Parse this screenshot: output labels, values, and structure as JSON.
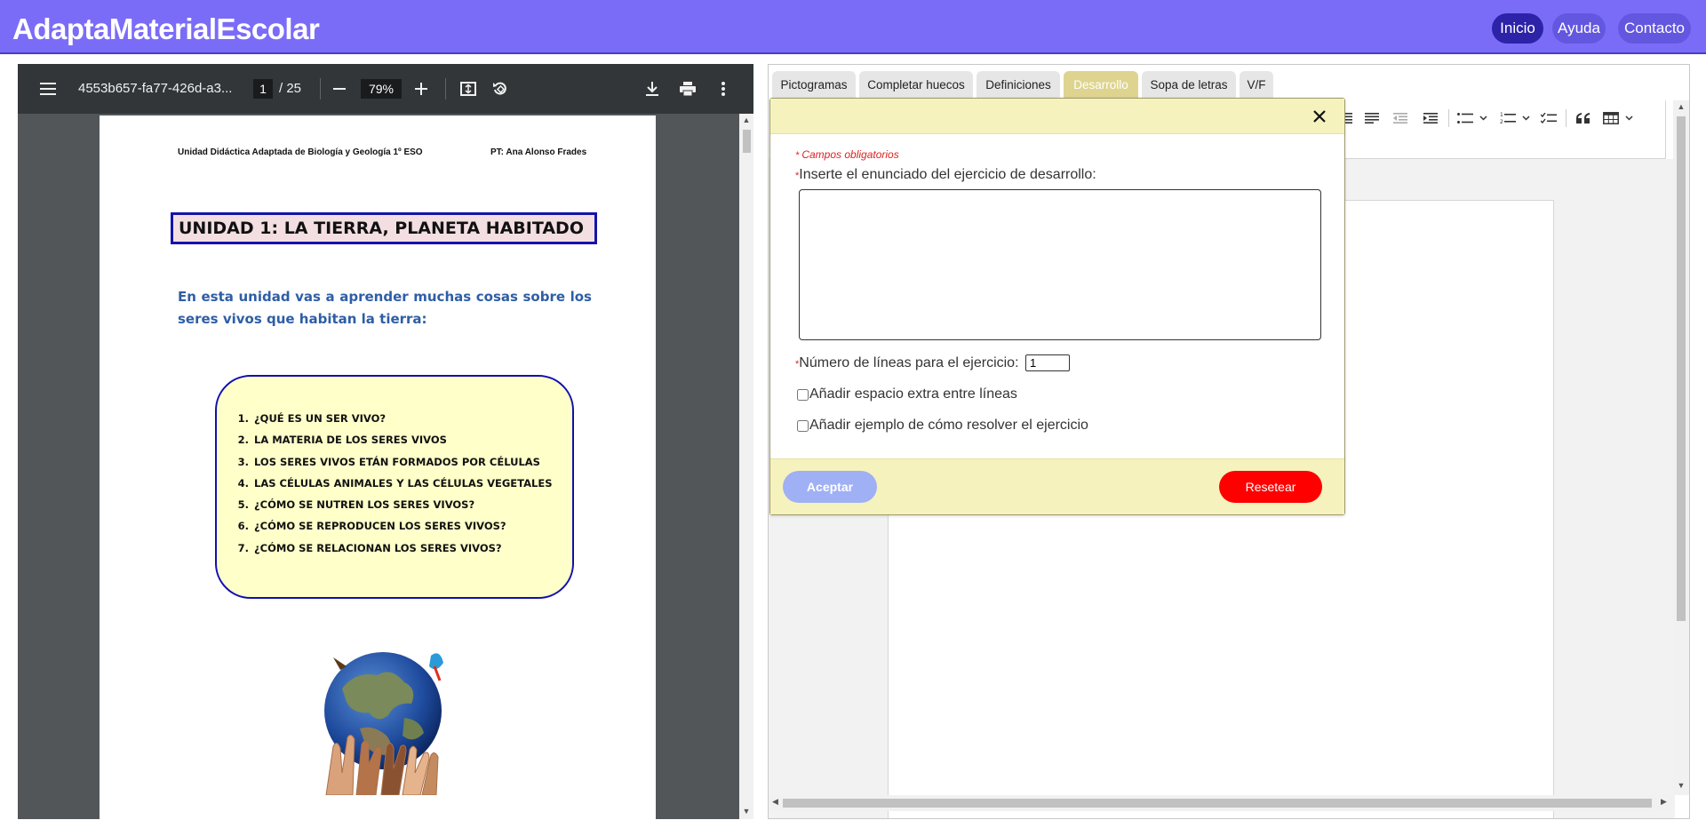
{
  "header": {
    "brand": "AdaptaMaterialEscolar",
    "nav": [
      "Inicio",
      "Ayuda",
      "Contacto"
    ],
    "active_nav": "Inicio",
    "colors": {
      "bar": "#7b6cf8",
      "active": "#2c23a8",
      "pill": "#6357e0"
    }
  },
  "pdf_viewer": {
    "filename": "4553b657-fa77-426d-a3...",
    "page_current": "1",
    "page_total": "/ 25",
    "zoom": "79%",
    "icons": [
      "menu-icon",
      "zoom-out-icon",
      "zoom-in-icon",
      "fit-page-icon",
      "rotate-icon",
      "download-icon",
      "print-icon",
      "more-vert-icon"
    ]
  },
  "document": {
    "header_left": "Unidad Didáctica Adaptada de Biología y Geología 1º ESO",
    "header_right": "PT: Ana Alonso Frades",
    "unit_title": "UNIDAD 1: LA TIERRA, PLANETA HABITADO",
    "intro": "En esta unidad vas a aprender muchas cosas sobre los seres vivos que habitan la tierra:",
    "index": [
      "¿QUÉ ES UN SER VIVO?",
      "LA MATERIA DE LOS SERES VIVOS",
      "LOS SERES VIVOS ETÁN FORMADOS POR CÉLULAS",
      "LAS CÉLULAS ANIMALES Y LAS CÉLULAS VEGETALES",
      "¿CÓMO SE NUTREN LOS SERES VIVOS?",
      "¿CÓMO SE REPRODUCEN LOS SERES VIVOS?",
      "¿CÓMO SE RELACIONAN LOS SERES VIVOS?"
    ]
  },
  "exercise_tabs": {
    "tabs": [
      "Pictogramas",
      "Completar huecos",
      "Definiciones",
      "Desarrollo",
      "Sopa de letras",
      "V/F"
    ],
    "active": "Desarrollo"
  },
  "modal": {
    "required_note": "Campos obligatorios",
    "statement_label": "Inserte el enunciado del ejercicio de desarrollo:",
    "statement_value": "",
    "lines_label": "Número de líneas para el ejercicio:",
    "lines_value": "1",
    "extra_space_label": "Añadir espacio extra entre líneas",
    "example_label": "Añadir ejemplo de cómo resolver el ejercicio",
    "extra_space_checked": false,
    "example_checked": false,
    "accept_label": "Aceptar",
    "reset_label": "Resetear",
    "colors": {
      "band": "#f6f2bd",
      "accept": "#9fb0f5",
      "reset": "#ff0000",
      "required": "#e02020"
    }
  },
  "editor_toolbar": {
    "icons": [
      "align-justify-icon",
      "align-left-icon",
      "outdent-icon",
      "indent-icon",
      "bulleted-list-icon",
      "chevron-down-icon",
      "numbered-list-icon",
      "chevron-down-icon",
      "todo-list-icon",
      "blockquote-icon",
      "table-icon",
      "chevron-down-icon"
    ]
  }
}
